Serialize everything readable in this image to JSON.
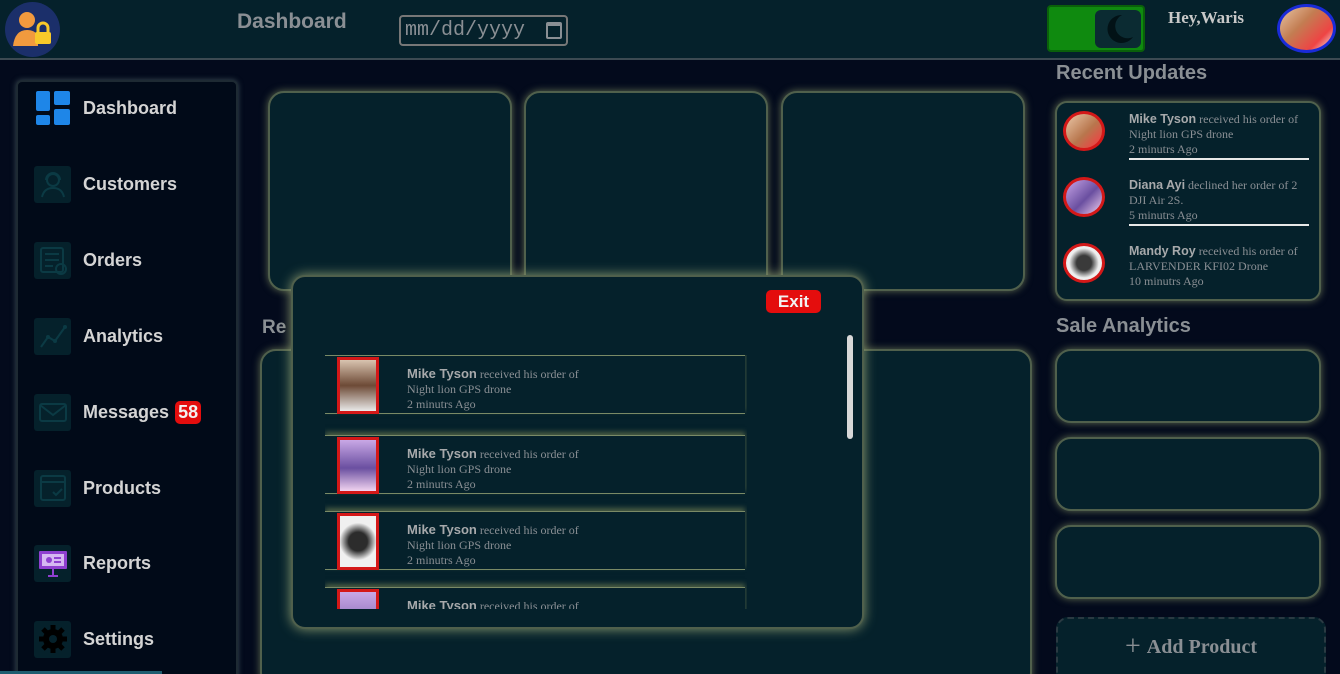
{
  "header": {
    "title": "Dashboard",
    "date_placeholder": "mm/dd/yyyy",
    "greeting": "Hey,Waris"
  },
  "sidebar": {
    "items": [
      {
        "label": "Dashboard",
        "icon": "dashboard-grid-icon"
      },
      {
        "label": "Customers",
        "icon": "customer-support-icon"
      },
      {
        "label": "Orders",
        "icon": "orders-list-icon"
      },
      {
        "label": "Analytics",
        "icon": "line-chart-icon"
      },
      {
        "label": "Messages",
        "icon": "envelope-icon",
        "badge": "58"
      },
      {
        "label": "Products",
        "icon": "product-check-icon"
      },
      {
        "label": "Reports",
        "icon": "presentation-board-icon"
      },
      {
        "label": "Settings",
        "icon": "gear-icon"
      }
    ]
  },
  "main": {
    "section_label": "Re"
  },
  "right": {
    "recent_updates_title": "Recent Updates",
    "updates": [
      {
        "name": "Mike Tyson",
        "text": "received his order of Night lion GPS drone",
        "time": "2 minutrs Ago"
      },
      {
        "name": "Diana Ayi",
        "text": "declined her order of 2 DJI Air 2S.",
        "time": "5 minutrs Ago"
      },
      {
        "name": "Mandy Roy",
        "text": "received his order of LARVENDER KFI02 Drone",
        "time": "10 minutrs Ago"
      }
    ],
    "sale_analytics_title": "Sale Analytics",
    "add_product_label": "Add Product"
  },
  "modal": {
    "exit_label": "Exit",
    "items": [
      {
        "name": "Mike Tyson",
        "text": "received his order of",
        "line2": "Night lion GPS drone",
        "time": "2 minutrs Ago"
      },
      {
        "name": "Mike Tyson",
        "text": "received his order of",
        "line2": "Night lion GPS drone",
        "time": "2 minutrs Ago"
      },
      {
        "name": "Mike Tyson",
        "text": "received his order of",
        "line2": "Night lion GPS drone",
        "time": "2 minutrs Ago"
      },
      {
        "name": "Mike Tyson",
        "text": "received his order of",
        "line2": "",
        "time": ""
      }
    ]
  },
  "colors": {
    "background": "#030a1c",
    "panel": "#05212b",
    "accent_red": "#e40d0d",
    "toggle_green": "#0f8a0f"
  }
}
